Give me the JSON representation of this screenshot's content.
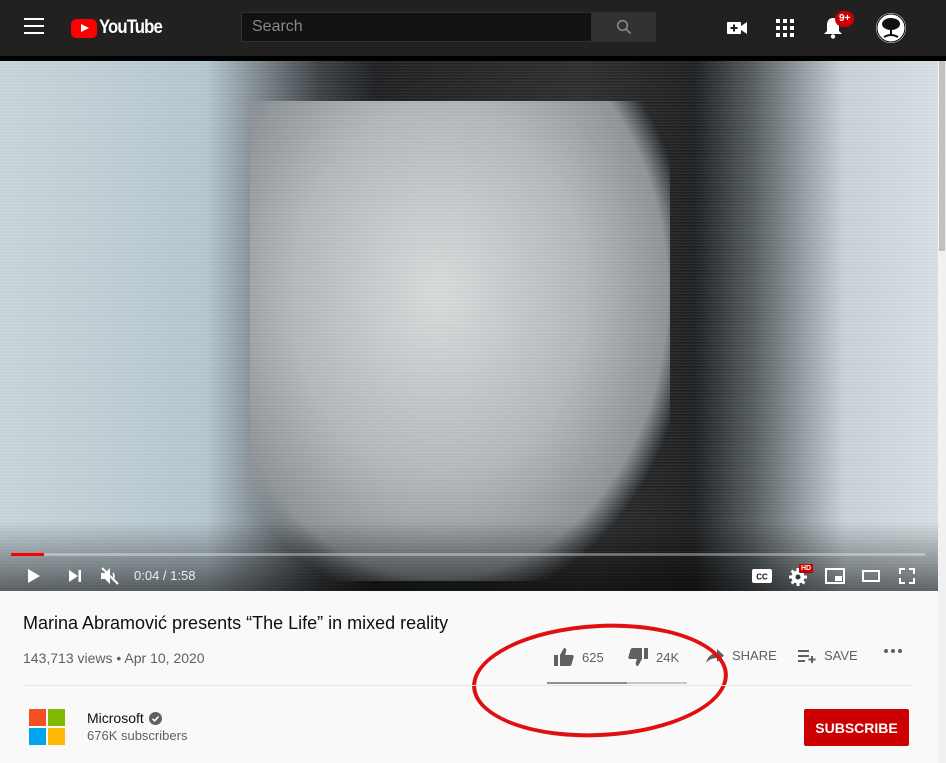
{
  "header": {
    "logo_text": "YouTube",
    "search_placeholder": "Search",
    "notification_count": "9+"
  },
  "player": {
    "current_time": "0:04",
    "duration": "1:58",
    "time_display": "0:04 / 1:58",
    "progress_fraction": 0.036,
    "hd_badge": "HD"
  },
  "video": {
    "title": "Marina Abramović presents “The Life” in mixed reality",
    "views_date": "143,713 views • Apr 10, 2020"
  },
  "actions": {
    "like_count": "625",
    "dislike_count": "24K",
    "share_label": "SHARE",
    "save_label": "SAVE",
    "like_fraction": 0.57
  },
  "channel": {
    "name": "Microsoft",
    "subscribers": "676K subscribers",
    "subscribe_label": "SUBSCRIBE"
  },
  "colors": {
    "accent": "#cc0000",
    "annotation": "#e01010"
  }
}
